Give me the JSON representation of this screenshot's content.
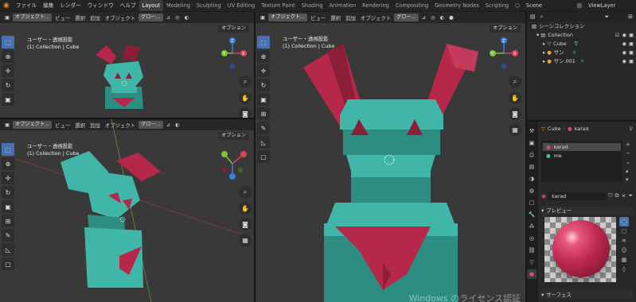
{
  "topbar": {
    "menu": [
      "ファイル",
      "編集",
      "レンダー",
      "ウィンドウ",
      "ヘルプ"
    ],
    "workspaces": [
      "Layout",
      "Modeling",
      "Sculpting",
      "UV Editing",
      "Texture Paint",
      "Shading",
      "Animation",
      "Rendering",
      "Compositing",
      "Geometry Nodes",
      "Scripting"
    ],
    "active_workspace": "Layout",
    "scene": "Scene",
    "view_layer": "ViewLayer"
  },
  "viewport_header": {
    "mode": "オブジェクト...",
    "view": "ビュー",
    "select": "選択",
    "add": "追加",
    "object": "オブジェクト",
    "transform": "グロー...",
    "options": "オプション"
  },
  "viewport_info": {
    "projection": "ユーザー・透視投影",
    "collection": "(1) Collection | Cube"
  },
  "gizmo": {
    "x": "X",
    "y": "Y",
    "z": "Z"
  },
  "outliner": {
    "title": "シーンコレクション",
    "collection": "Collection",
    "items": [
      "Cube",
      "サン",
      "サン.001"
    ]
  },
  "properties": {
    "breadcrumb_object": "Cube",
    "breadcrumb_material": "karad",
    "slots": [
      "karad",
      "me"
    ],
    "material_name": "karad",
    "preview_label": "プレビュー",
    "surface_label": "サーフェス"
  },
  "watermark": "Windows のライセンス認証",
  "colors": {
    "teal": "#3fb6a8",
    "teal_dark": "#2c8d80",
    "red": "#b5284a",
    "red_dark": "#8a1f37",
    "accent_blue": "#4772b3",
    "gizmo_x": "#e0415d",
    "gizmo_y": "#7bc43a",
    "gizmo_z": "#3b7be2"
  }
}
